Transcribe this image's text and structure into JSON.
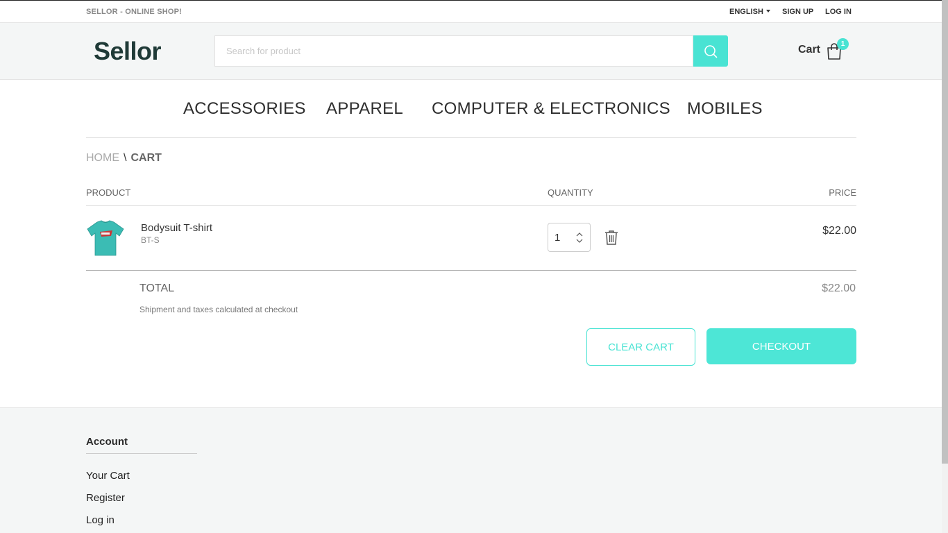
{
  "topbar": {
    "tagline": "SELLOR - ONLINE SHOP!",
    "language": "ENGLISH",
    "signup": "SIGN UP",
    "login": "LOG IN"
  },
  "header": {
    "logo": "Sellor",
    "search_placeholder": "Search for product",
    "cart_label": "Cart",
    "cart_count": "1",
    "accent_color": "#49e3d3"
  },
  "categories": [
    "ACCESSORIES",
    "APPAREL",
    "COMPUTER & ELECTRONICS",
    "MOBILES"
  ],
  "breadcrumb": {
    "home": "HOME",
    "separator": "\\",
    "current": "CART"
  },
  "cart": {
    "headers": {
      "product": "PRODUCT",
      "quantity": "QUANTITY",
      "price": "PRICE"
    },
    "items": [
      {
        "name": "Bodysuit T-shirt",
        "sku": "BT-S",
        "quantity": "1",
        "price": "$22.00"
      }
    ],
    "total_label": "TOTAL",
    "total_value": "$22.00",
    "shipping_note": "Shipment and taxes calculated at checkout",
    "clear_label": "CLEAR CART",
    "checkout_label": "CHECKOUT"
  },
  "footer": {
    "heading": "Account",
    "links": [
      "Your Cart",
      "Register",
      "Log in"
    ]
  }
}
